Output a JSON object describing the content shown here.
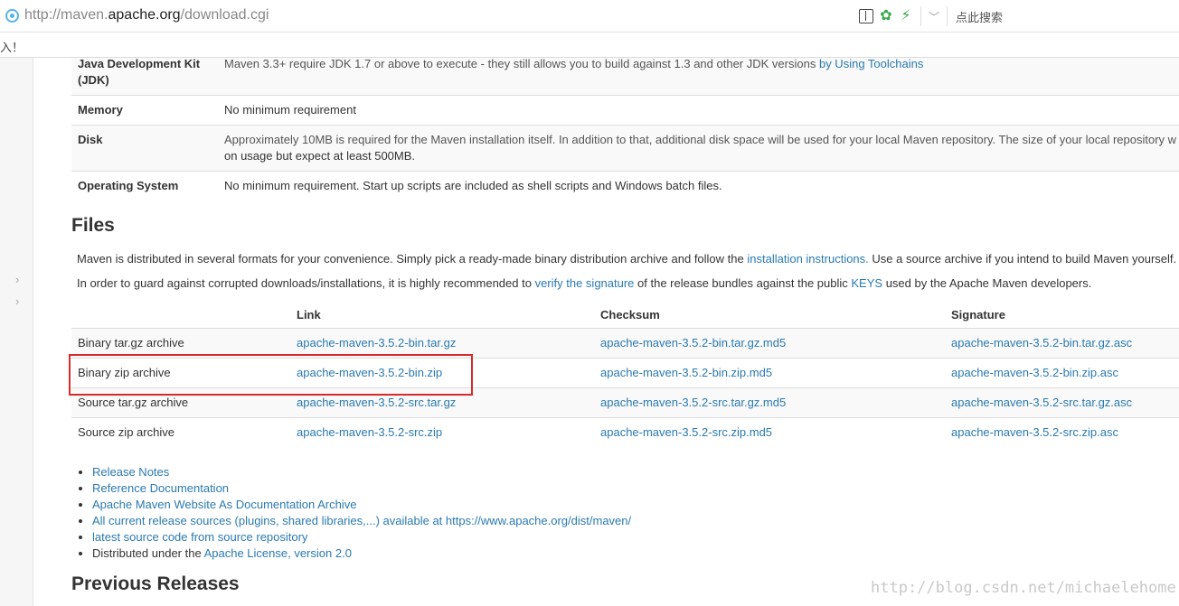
{
  "browser": {
    "url_prefix": "http://maven.",
    "url_host": "apache.org",
    "url_suffix": "/download.cgi",
    "search_hint": "点此搜索",
    "bookmark_text": "入！"
  },
  "requirements": [
    {
      "key": "Java Development Kit (JDK)",
      "value": "Maven 3.3+ require JDK 1.7 or above to execute - they still allows you to build against 1.3 and other JDK versions",
      "link": "by Using Toolchains"
    },
    {
      "key": "Memory",
      "value": "No minimum requirement"
    },
    {
      "key": "Disk",
      "value": "Approximately 10MB is required for the Maven installation itself. In addition to that, additional disk space will be used for your local Maven repository. The size of your local repository w",
      "value2": "on usage but expect at least 500MB."
    },
    {
      "key": "Operating System",
      "value": "No minimum requirement. Start up scripts are included as shell scripts and Windows batch files."
    }
  ],
  "files": {
    "heading": "Files",
    "intro_before": "Maven is distributed in several formats for your convenience. Simply pick a ready-made binary distribution archive and follow the",
    "intro_link": "installation instructions.",
    "intro_after": "Use a source archive if you intend to build Maven yourself.",
    "verify_before": "In order to guard against corrupted downloads/installations, it is highly recommended to",
    "verify_link": "verify the signature",
    "verify_mid": "of the release bundles against the public",
    "verify_keys": "KEYS",
    "verify_after": "used by the Apache Maven developers.",
    "columns": [
      "",
      "Link",
      "Checksum",
      "Signature"
    ],
    "rows": [
      {
        "name": "Binary tar.gz archive",
        "link": "apache-maven-3.5.2-bin.tar.gz",
        "checksum": "apache-maven-3.5.2-bin.tar.gz.md5",
        "signature": "apache-maven-3.5.2-bin.tar.gz.asc"
      },
      {
        "name": "Binary zip archive",
        "link": "apache-maven-3.5.2-bin.zip",
        "checksum": "apache-maven-3.5.2-bin.zip.md5",
        "signature": "apache-maven-3.5.2-bin.zip.asc"
      },
      {
        "name": "Source tar.gz archive",
        "link": "apache-maven-3.5.2-src.tar.gz",
        "checksum": "apache-maven-3.5.2-src.tar.gz.md5",
        "signature": "apache-maven-3.5.2-src.tar.gz.asc"
      },
      {
        "name": "Source zip archive",
        "link": "apache-maven-3.5.2-src.zip",
        "checksum": "apache-maven-3.5.2-src.zip.md5",
        "signature": "apache-maven-3.5.2-src.zip.asc"
      }
    ],
    "list": [
      {
        "link": "Release Notes"
      },
      {
        "link": "Reference Documentation"
      },
      {
        "link": "Apache Maven Website As Documentation Archive"
      },
      {
        "link": "All current release sources (plugins, shared libraries,...) available at https://www.apache.org/dist/maven/"
      },
      {
        "link": "latest source code from source repository"
      },
      {
        "text": "Distributed under the",
        "link": "Apache License, version 2.0"
      }
    ]
  },
  "previous": {
    "heading": "Previous Releases"
  },
  "watermark": "http://blog.csdn.net/michaelehome",
  "colors": {
    "link": "#2a7ab0",
    "highlight_box": "#d9292a"
  }
}
